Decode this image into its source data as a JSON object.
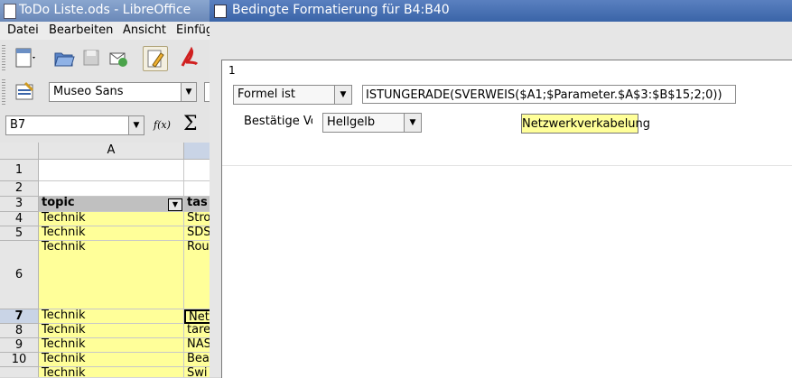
{
  "main_window": {
    "title": "ToDo Liste.ods - LibreOffice",
    "menu": [
      "Datei",
      "Bearbeiten",
      "Ansicht",
      "Einfüg"
    ],
    "font_name": "Museo Sans",
    "name_box": "B7",
    "function_wizard_label": "f(x)",
    "sum_symbol": "Σ",
    "columns": [
      "A",
      ""
    ],
    "rows": [
      {
        "num": "1",
        "a": "",
        "b": ""
      },
      {
        "num": "2",
        "a": "",
        "b": ""
      },
      {
        "num": "3",
        "a": "topic",
        "b": "tas"
      },
      {
        "num": "4",
        "a": "Technik",
        "b": "Stro"
      },
      {
        "num": "5",
        "a": "Technik",
        "b": "SDS"
      },
      {
        "num": "6",
        "a": "Technik",
        "b": "Rou"
      },
      {
        "num": "7",
        "a": "Technik",
        "b": "Net"
      },
      {
        "num": "8",
        "a": "Technik",
        "b": "tare"
      },
      {
        "num": "9",
        "a": "Technik",
        "b": "NAS"
      },
      {
        "num": "10",
        "a": "Technik",
        "b": "Bea"
      },
      {
        "num": "",
        "a": "Technik",
        "b": "Swi"
      }
    ],
    "colors": {
      "highlight_fill": "#ffff99",
      "header_fill": "#c0c0c0"
    }
  },
  "dialog": {
    "title": "Bedingte Formatierung für B4:B40",
    "condition_index": "1",
    "condition_type": "Formel ist",
    "formula": "ISTUNGERADE(SVERWEIS($A1;$Parameter.$A$3:$B$15;2;0))",
    "apply_style_label": "Bestätige Vo",
    "style": "Hellgelb",
    "preview_text": "Netzwerkverkabelung",
    "colors": {
      "titlebar": "#4a72b4",
      "preview_fill": "#ffff99"
    }
  }
}
